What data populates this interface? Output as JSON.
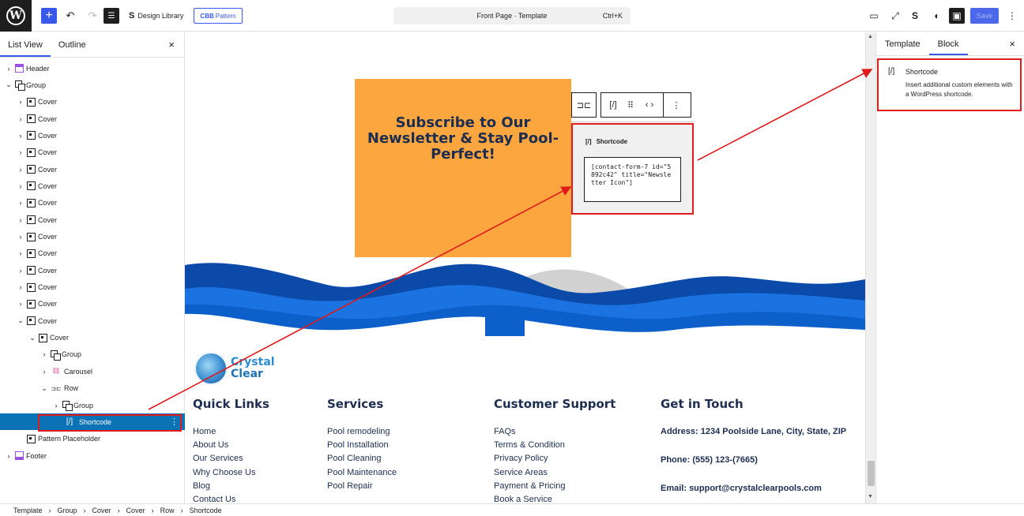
{
  "topbar": {
    "design_library_label": "Design Library",
    "pattern_badge": "CBB",
    "pattern_label": "Pattern",
    "document_title": "Front Page · Template",
    "shortcut_hint": "Ctrl+K",
    "save_label": "Save"
  },
  "list_panel": {
    "tabs": [
      "List View",
      "Outline"
    ],
    "tree": [
      {
        "label": "Header",
        "icon": "header",
        "depth": 0,
        "chev": ">"
      },
      {
        "label": "Group",
        "icon": "group",
        "depth": 0,
        "chev": "v"
      },
      {
        "label": "Cover",
        "icon": "cover",
        "depth": 1,
        "chev": ">"
      },
      {
        "label": "Cover",
        "icon": "cover",
        "depth": 1,
        "chev": ">"
      },
      {
        "label": "Cover",
        "icon": "cover",
        "depth": 1,
        "chev": ">"
      },
      {
        "label": "Cover",
        "icon": "cover",
        "depth": 1,
        "chev": ">"
      },
      {
        "label": "Cover",
        "icon": "cover",
        "depth": 1,
        "chev": ">"
      },
      {
        "label": "Cover",
        "icon": "cover",
        "depth": 1,
        "chev": ">"
      },
      {
        "label": "Cover",
        "icon": "cover",
        "depth": 1,
        "chev": ">"
      },
      {
        "label": "Cover",
        "icon": "cover",
        "depth": 1,
        "chev": ">"
      },
      {
        "label": "Cover",
        "icon": "cover",
        "depth": 1,
        "chev": ">"
      },
      {
        "label": "Cover",
        "icon": "cover",
        "depth": 1,
        "chev": ">"
      },
      {
        "label": "Cover",
        "icon": "cover",
        "depth": 1,
        "chev": ">"
      },
      {
        "label": "Cover",
        "icon": "cover",
        "depth": 1,
        "chev": ">"
      },
      {
        "label": "Cover",
        "icon": "cover",
        "depth": 1,
        "chev": ">"
      },
      {
        "label": "Cover",
        "icon": "cover",
        "depth": 1,
        "chev": "v"
      },
      {
        "label": "Cover",
        "icon": "cover",
        "depth": 2,
        "chev": "v"
      },
      {
        "label": "Group",
        "icon": "group",
        "depth": 3,
        "chev": ">"
      },
      {
        "label": "Carousel",
        "icon": "carousel",
        "depth": 3,
        "chev": ">"
      },
      {
        "label": "Row",
        "icon": "row",
        "depth": 3,
        "chev": "v"
      },
      {
        "label": "Group",
        "icon": "group",
        "depth": 4,
        "chev": ">"
      },
      {
        "label": "Shortcode",
        "icon": "shortcode",
        "depth": 4,
        "chev": "",
        "selected": true
      },
      {
        "label": "Pattern Placeholder",
        "icon": "cover",
        "depth": 1,
        "chev": ""
      },
      {
        "label": "Footer",
        "icon": "footer",
        "depth": 0,
        "chev": ">"
      }
    ]
  },
  "canvas": {
    "newsletter_heading": "Subscribe to Our Newsletter & Stay Pool-Perfect!",
    "shortcode_block": {
      "title": "Shortcode",
      "value": "[contact-form-7 id=\"5892c42\" title=\"Newsletter Icon\"]"
    },
    "brand_line1": "Crystal",
    "brand_line2": "Clear",
    "footer": {
      "quick_links": {
        "heading": "Quick Links",
        "items": [
          "Home",
          "About Us",
          "Our Services",
          "Why Choose Us",
          "Blog",
          "Contact Us"
        ]
      },
      "services": {
        "heading": "Services",
        "items": [
          "Pool remodeling",
          "Pool Installation",
          "Pool Cleaning",
          "Pool Maintenance",
          "Pool Repair"
        ]
      },
      "support": {
        "heading": "Customer Support",
        "items": [
          "FAQs",
          "Terms & Condition",
          "Privacy Policy",
          "Service Areas",
          "Payment & Pricing",
          "Book a Service"
        ]
      },
      "contact": {
        "heading": "Get in Touch",
        "items": [
          "Address: 1234 Poolside Lane, City, State, ZIP",
          "Phone: (555) 123-(7665)",
          "Email: support@crystalclearpools.com"
        ]
      }
    }
  },
  "settings_panel": {
    "tabs": [
      "Template",
      "Block"
    ],
    "block_title": "Shortcode",
    "block_description": "Insert additional custom elements with a WordPress shortcode."
  },
  "breadcrumb": [
    "Template",
    "Group",
    "Cover",
    "Cover",
    "Row",
    "Shortcode"
  ],
  "colors": {
    "accent": "#3858e9",
    "highlight": "#e01b1b",
    "selected_row": "#0b72b6",
    "newsletter_bg": "#fba63f",
    "footer_text": "#1c2d4f"
  }
}
